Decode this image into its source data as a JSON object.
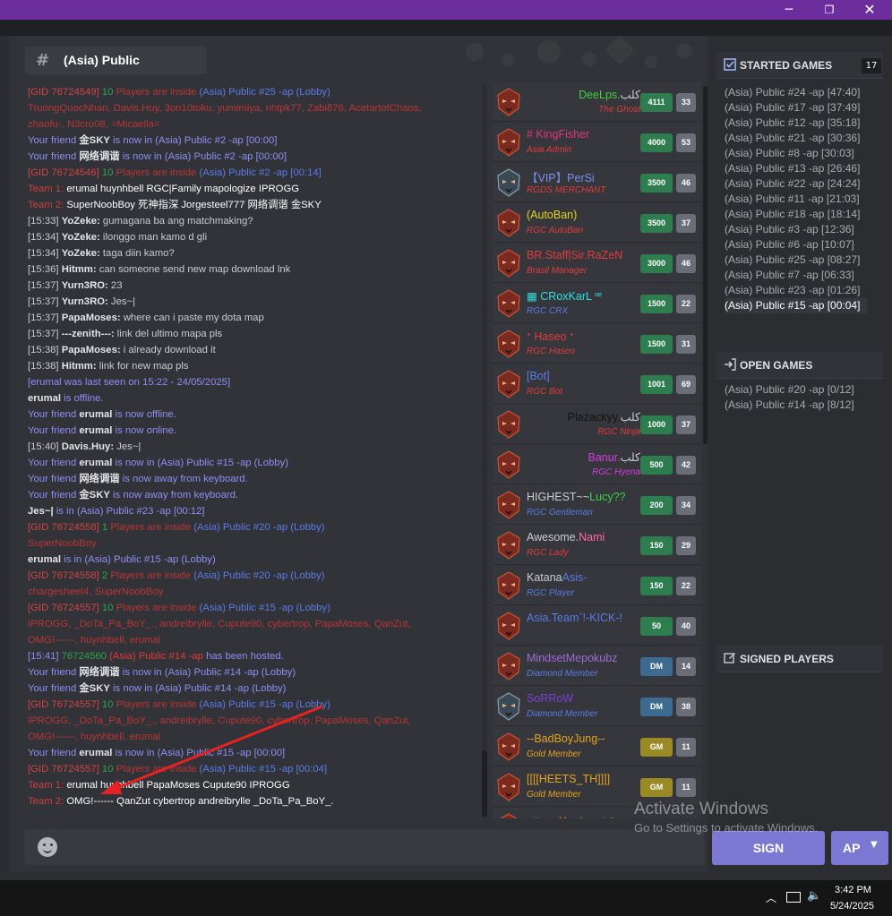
{
  "window": {
    "min": "─",
    "max": "❐",
    "close": "✕"
  },
  "channel": {
    "title": "(Asia) Public",
    "hash": "#"
  },
  "chat": [
    [
      {
        "t": "[GID 76724549]",
        "c": "c-gid"
      },
      {
        "t": " 10 ",
        "c": "c-green"
      },
      {
        "t": "Players are inside",
        "c": "c-dkred"
      },
      {
        "t": " (Asia) Public #25 -ap (Lobby)",
        "c": "c-blue"
      }
    ],
    [
      {
        "t": "TruongQuocNhan, Davis.Huy, 3on10toku, yumimiya, nhtpk77, Zabi876, AcetartofChaos,",
        "c": "c-dkred"
      }
    ],
    [
      {
        "t": "zhaofu-, N3cro08, =Micaella=",
        "c": "c-dkred"
      }
    ],
    [
      {
        "t": "Your friend ",
        "c": "c-friend"
      },
      {
        "t": "金SKY",
        "c": "c-white"
      },
      {
        "t": " is now in (Asia) Public #2 -ap [00:00]",
        "c": "c-friend"
      }
    ],
    [
      {
        "t": "Your friend ",
        "c": "c-friend"
      },
      {
        "t": "网络调谐",
        "c": "c-white"
      },
      {
        "t": " is now in (Asia) Public #2 -ap [00:00]",
        "c": "c-friend"
      }
    ],
    [
      {
        "t": "[GID 76724546]",
        "c": "c-gid"
      },
      {
        "t": " 10 ",
        "c": "c-green"
      },
      {
        "t": "Players are inside",
        "c": "c-dkred"
      },
      {
        "t": " (Asia) Public #2 -ap [00:14]",
        "c": "c-blue"
      }
    ],
    [
      {
        "t": "Team 1:",
        "c": "c-team"
      },
      {
        "t": "   erumal   huynhbell   RGC|Family   mapologize   IPROGG",
        "c": "c-teamname"
      }
    ],
    [
      {
        "t": "Team 2:",
        "c": "c-team"
      },
      {
        "t": "   SuperNoobBoy   死神指深   Jorgesteel777   网络调谐   金SKY",
        "c": "c-teamname"
      }
    ],
    [
      {
        "t": "[15:33] ",
        "c": "c-msg"
      },
      {
        "t": "YoZeke:",
        "c": "c-name"
      },
      {
        "t": " gumagana ba ang matchmaking?",
        "c": "c-msg"
      }
    ],
    [
      {
        "t": "[15:34] ",
        "c": "c-msg"
      },
      {
        "t": "YoZeke:",
        "c": "c-name"
      },
      {
        "t": " ilonggo man kamo d gli",
        "c": "c-msg"
      }
    ],
    [
      {
        "t": "[15:34] ",
        "c": "c-msg"
      },
      {
        "t": "YoZeke:",
        "c": "c-name"
      },
      {
        "t": " taga diin kamo?",
        "c": "c-msg"
      }
    ],
    [
      {
        "t": "[15:36] ",
        "c": "c-msg"
      },
      {
        "t": "Hitmm:",
        "c": "c-name"
      },
      {
        "t": " can someone send new map download lnk",
        "c": "c-msg"
      }
    ],
    [
      {
        "t": "[15:37] ",
        "c": "c-msg"
      },
      {
        "t": "Yurn3RO:",
        "c": "c-name"
      },
      {
        "t": " 23",
        "c": "c-msg"
      }
    ],
    [
      {
        "t": "[15:37] ",
        "c": "c-msg"
      },
      {
        "t": "Yurn3RO:",
        "c": "c-name"
      },
      {
        "t": " Jes~|",
        "c": "c-msg"
      }
    ],
    [
      {
        "t": "[15:37] ",
        "c": "c-msg"
      },
      {
        "t": "PapaMoses:",
        "c": "c-name"
      },
      {
        "t": " where can i paste my dota map",
        "c": "c-msg"
      }
    ],
    [
      {
        "t": "[15:37] ",
        "c": "c-msg"
      },
      {
        "t": "---zenith---:",
        "c": "c-name"
      },
      {
        "t": " link del ultimo mapa pls",
        "c": "c-msg"
      }
    ],
    [
      {
        "t": "[15:38] ",
        "c": "c-msg"
      },
      {
        "t": "PapaMoses:",
        "c": "c-name"
      },
      {
        "t": " i already download it",
        "c": "c-msg"
      }
    ],
    [
      {
        "t": "[15:38] ",
        "c": "c-msg"
      },
      {
        "t": "Hitmm:",
        "c": "c-name"
      },
      {
        "t": " link for new map pls",
        "c": "c-msg"
      }
    ],
    [
      {
        "t": "[erumal was last seen on 15:22 - 24/05/2025]",
        "c": "c-friend"
      }
    ],
    [
      {
        "t": "erumal",
        "c": "c-white"
      },
      {
        "t": " is offline.",
        "c": "c-friend"
      }
    ],
    [
      {
        "t": "Your friend ",
        "c": "c-friend"
      },
      {
        "t": "erumal",
        "c": "c-white"
      },
      {
        "t": " is now offline.",
        "c": "c-friend"
      }
    ],
    [
      {
        "t": "Your friend ",
        "c": "c-friend"
      },
      {
        "t": "erumal",
        "c": "c-white"
      },
      {
        "t": " is now online.",
        "c": "c-friend"
      }
    ],
    [
      {
        "t": "[15:40] ",
        "c": "c-msg"
      },
      {
        "t": "Davis.Huy:",
        "c": "c-name"
      },
      {
        "t": " Jes~|",
        "c": "c-msg"
      }
    ],
    [
      {
        "t": "Your friend ",
        "c": "c-friend"
      },
      {
        "t": "erumal",
        "c": "c-white"
      },
      {
        "t": " is now in (Asia) Public #15 -ap (Lobby)",
        "c": "c-friend"
      }
    ],
    [
      {
        "t": "Your friend ",
        "c": "c-friend"
      },
      {
        "t": "网络调谐",
        "c": "c-white"
      },
      {
        "t": " is now away from keyboard.",
        "c": "c-friend"
      }
    ],
    [
      {
        "t": "Your friend ",
        "c": "c-friend"
      },
      {
        "t": "金SKY",
        "c": "c-white"
      },
      {
        "t": " is now away from keyboard.",
        "c": "c-friend"
      }
    ],
    [
      {
        "t": "Jes~|",
        "c": "c-white"
      },
      {
        "t": " is in (Asia) Public #23 -ap [00:12]",
        "c": "c-friend"
      }
    ],
    [
      {
        "t": "[GID 76724558]",
        "c": "c-gid"
      },
      {
        "t": " 1 ",
        "c": "c-green"
      },
      {
        "t": "Players are inside",
        "c": "c-dkred"
      },
      {
        "t": " (Asia) Public #20 -ap (Lobby)",
        "c": "c-blue"
      }
    ],
    [
      {
        "t": "SuperNoobBoy",
        "c": "c-dkred"
      }
    ],
    [
      {
        "t": "erumal",
        "c": "c-white"
      },
      {
        "t": " is in (Asia) Public #15 -ap (Lobby)",
        "c": "c-friend"
      }
    ],
    [
      {
        "t": "[GID 76724558]",
        "c": "c-gid"
      },
      {
        "t": " 2 ",
        "c": "c-green"
      },
      {
        "t": "Players are inside",
        "c": "c-dkred"
      },
      {
        "t": " (Asia) Public #20 -ap (Lobby)",
        "c": "c-blue"
      }
    ],
    [
      {
        "t": "chargesheet4, SuperNoobBoy",
        "c": "c-dkred"
      }
    ],
    [
      {
        "t": "[GID 76724557]",
        "c": "c-gid"
      },
      {
        "t": " 10 ",
        "c": "c-green"
      },
      {
        "t": "Players are inside",
        "c": "c-dkred"
      },
      {
        "t": " (Asia) Public #15 -ap (Lobby)",
        "c": "c-blue"
      }
    ],
    [
      {
        "t": "IPROGG, _DoTa_Pa_BoY_., andreibrylle, Cupute90, cybertrop, PapaMoses, QanZut,",
        "c": "c-dkred"
      }
    ],
    [
      {
        "t": "OMG!------, huynhbell, erumal",
        "c": "c-dkred"
      }
    ],
    [
      {
        "t": "[15:41] ",
        "c": "c-friend"
      },
      {
        "t": " 76724560 ",
        "c": "c-green"
      },
      {
        "t": "(Asia) Public #14 -ap",
        "c": "c-hosted"
      },
      {
        "t": " has been hosted.",
        "c": "c-friend"
      }
    ],
    [
      {
        "t": "Your friend ",
        "c": "c-friend"
      },
      {
        "t": "网络调谐",
        "c": "c-white"
      },
      {
        "t": " is now in (Asia) Public #14 -ap (Lobby)",
        "c": "c-friend"
      }
    ],
    [
      {
        "t": "Your friend ",
        "c": "c-friend"
      },
      {
        "t": "金SKY",
        "c": "c-white"
      },
      {
        "t": " is now in (Asia) Public #14 -ap (Lobby)",
        "c": "c-friend"
      }
    ],
    [
      {
        "t": "[GID 76724557]",
        "c": "c-gid"
      },
      {
        "t": " 10 ",
        "c": "c-green"
      },
      {
        "t": "Players are inside",
        "c": "c-dkred"
      },
      {
        "t": " (Asia) Public #15 -ap (Lobby)",
        "c": "c-blue"
      }
    ],
    [
      {
        "t": "IPROGG, _DoTa_Pa_BoY_., andreibrylle, Cupute90, cybertrop, PapaMoses, QanZut,",
        "c": "c-dkred"
      }
    ],
    [
      {
        "t": "OMG!------, huynhbell, erumal",
        "c": "c-dkred"
      }
    ],
    [
      {
        "t": "Your friend ",
        "c": "c-friend"
      },
      {
        "t": "erumal",
        "c": "c-white"
      },
      {
        "t": " is now in (Asia) Public #15 -ap [00:00]",
        "c": "c-friend"
      }
    ],
    [
      {
        "t": "[GID 76724557]",
        "c": "c-gid"
      },
      {
        "t": " 10 ",
        "c": "c-green"
      },
      {
        "t": "Players are inside",
        "c": "c-dkred"
      },
      {
        "t": " (Asia) Public #15 -ap [00:04]",
        "c": "c-blue"
      }
    ],
    [
      {
        "t": "Team 1:",
        "c": "c-team"
      },
      {
        "t": "   erumal   huynhbell   PapaMoses   Cupute90   IPROGG",
        "c": "c-teamname"
      }
    ],
    [
      {
        "t": "Team 2:",
        "c": "c-team"
      },
      {
        "t": "   OMG!------   QanZut   cybertrop   andreibrylle   _DoTa_Pa_BoY_.",
        "c": "c-teamname"
      }
    ]
  ],
  "players": [
    {
      "name": "DeeLps.",
      "suffix": "كلب",
      "name_color": "#3fd13f",
      "suffix_color": "#c9cbd0",
      "sub": "The Ghost",
      "sub_color": "#e23b3b",
      "align": "right",
      "score": "4111",
      "score_color": "#2e7d4f",
      "level": "33",
      "avatar": "red"
    },
    {
      "name": "# KingFisher",
      "name_color": "#e0367a",
      "sub": "Asia Admin",
      "sub_color": "#e23b3b",
      "align": "left",
      "score": "4000",
      "score_color": "#2e7d4f",
      "level": "53",
      "avatar": "red"
    },
    {
      "name": "【VIP】PerSi",
      "name_color": "#7b8ef0",
      "sub": "RGDS MERCHANT",
      "sub_color": "#e23b3b",
      "align": "left",
      "score": "3500",
      "score_color": "#2e7d4f",
      "level": "46",
      "avatar": "dark"
    },
    {
      "name": "(AutoBan)",
      "name_color": "#e6d21e",
      "sub": "RGC AutoBan",
      "sub_color": "#e23b3b",
      "align": "left",
      "score": "3500",
      "score_color": "#2e7d4f",
      "level": "37",
      "avatar": "red"
    },
    {
      "name": "BR.Staff|Sir.RaZeN",
      "name_color": "#e23b3b",
      "sub": "Brasil Manager",
      "sub_color": "#e23b3b",
      "align": "left",
      "score": "3000",
      "score_color": "#2e7d4f",
      "level": "46",
      "avatar": "red"
    },
    {
      "name": "▦ CRoxKarL ꟹ",
      "name_color": "#2ee0e0",
      "sub": "RGC CRX",
      "sub_color": "#5b7be6",
      "align": "left",
      "score": "1500",
      "score_color": "#2e7d4f",
      "level": "22",
      "avatar": "red"
    },
    {
      "name": "ᐩ Haseo ᐩ",
      "name_color": "#e23b3b",
      "sub": "RGC Haseo",
      "sub_color": "#e23b3b",
      "align": "left",
      "score": "1500",
      "score_color": "#2e7d4f",
      "level": "31",
      "avatar": "red"
    },
    {
      "name": "[Bot]",
      "name_color": "#5b7be6",
      "sub": "RGC Bot",
      "sub_color": "#e23b3b",
      "align": "left",
      "score": "1001",
      "score_color": "#2e7d4f",
      "level": "69",
      "avatar": "red"
    },
    {
      "name": "Plazackyy.",
      "suffix": "كلب",
      "name_color": "#111111",
      "suffix_color": "#c9cbd0",
      "sub": "RGC Ninja",
      "sub_color": "#e23b3b",
      "align": "right",
      "score": "1000",
      "score_color": "#2e7d4f",
      "level": "37",
      "avatar": "red"
    },
    {
      "name": "Banur.",
      "suffix": "كلب",
      "name_color": "#d53be0",
      "suffix_color": "#c9cbd0",
      "sub": "RGC Hyena",
      "sub_color": "#d53be0",
      "align": "right",
      "score": "500",
      "score_color": "#2e7d4f",
      "level": "42",
      "avatar": "red"
    },
    {
      "name": "HIGHEST~~",
      "suffix": "Lucy??",
      "name_color": "#c9cbd0",
      "suffix_color": "#3fd13f",
      "sub": "RGC Gentleman",
      "sub_color": "#5b7be6",
      "align": "left",
      "score": "200",
      "score_color": "#2e7d4f",
      "level": "34",
      "avatar": "red"
    },
    {
      "name": "Awesome.",
      "suffix": "Nami",
      "name_color": "#c9cbd0",
      "suffix_color": "#ff6aa8",
      "sub": "RGC Lady",
      "sub_color": "#e23b3b",
      "align": "left",
      "score": "150",
      "score_color": "#2e7d4f",
      "level": "29",
      "avatar": "red"
    },
    {
      "name": "Katana",
      "suffix": "Asis-",
      "name_color": "#c9cbd0",
      "suffix_color": "#5b7be6",
      "sub": "RGC Player",
      "sub_color": "#5b7be6",
      "align": "left",
      "score": "150",
      "score_color": "#2e7d4f",
      "level": "22",
      "avatar": "red"
    },
    {
      "name": "Asia.Team`!-KICK-!",
      "name_color": "#5b7be6",
      "sub": "",
      "sub_color": "#e23b3b",
      "align": "left",
      "score": "50",
      "score_color": "#2e7d4f",
      "level": "40",
      "avatar": "red"
    },
    {
      "name": "MindsetMepokubz",
      "name_color": "#a06ad8",
      "sub": "Diamond Member",
      "sub_color": "#5b7be6",
      "align": "left",
      "score": "DM",
      "score_color": "#3d6b8f",
      "level": "14",
      "avatar": "red"
    },
    {
      "name": "SoRRoW",
      "name_color": "#7b3fd8",
      "sub": "Diamond Member",
      "sub_color": "#5b7be6",
      "align": "left",
      "score": "DM",
      "score_color": "#3d6b8f",
      "level": "38",
      "avatar": "dark"
    },
    {
      "name": "--BadBoyJung--",
      "name_color": "#e6a21e",
      "sub": "Gold Member",
      "sub_color": "#e6a21e",
      "align": "left",
      "score": "GM",
      "score_color": "#9a8a25",
      "level": "11",
      "avatar": "red"
    },
    {
      "name": "[[[[HEETS_TH]]]]",
      "name_color": "#e6a21e",
      "sub": "Gold Member",
      "sub_color": "#e6a21e",
      "align": "left",
      "score": "GM",
      "score_color": "#9a8a25",
      "level": "11",
      "avatar": "red"
    },
    {
      "name": "Allstar神 - [Study] E",
      "name_color": "#e6a21e",
      "sub": "",
      "sub_color": "#e6a21e",
      "align": "left",
      "score": "",
      "score_color": "#9a8a25",
      "level": "",
      "avatar": "red"
    }
  ],
  "started_games": {
    "title": "STARTED GAMES",
    "count": "17",
    "items": [
      "(Asia) Public #24 -ap [47:40]",
      "(Asia) Public #17 -ap [37:49]",
      "(Asia) Public #12 -ap [35:18]",
      "(Asia) Public #21 -ap [30:36]",
      "(Asia) Public #8 -ap [30:03]",
      "(Asia) Public #13 -ap [26:46]",
      "(Asia) Public #22 -ap [24:24]",
      "(Asia) Public #11 -ap [21:03]",
      "(Asia) Public #18 -ap [18:14]",
      "(Asia) Public #3 -ap [12:36]",
      "(Asia) Public #6 -ap [10:07]",
      "(Asia) Public #25 -ap [08:27]",
      "(Asia) Public #7 -ap [06:33]",
      "(Asia) Public #23 -ap [01:26]",
      "(Asia) Public #15 -ap [00:04]"
    ],
    "selected_index": 14
  },
  "open_games": {
    "title": "OPEN GAMES",
    "items": [
      "(Asia) Public #20 -ap [0/12]",
      "(Asia) Public #14 -ap [8/12]"
    ]
  },
  "signed_players": {
    "title": "SIGNED PLAYERS"
  },
  "input": {
    "placeholder": ""
  },
  "buttons": {
    "sign": "SIGN",
    "ap": "AP"
  },
  "watermark": {
    "title": "Activate Windows",
    "sub": "Go to Settings to activate Windows."
  },
  "taskbar": {
    "time": "3:42 PM",
    "date": "5/24/2025"
  },
  "colors": {
    "titlebar": "#6d2e9d",
    "accent_button": "#7b78d4",
    "panel": "#313338"
  }
}
